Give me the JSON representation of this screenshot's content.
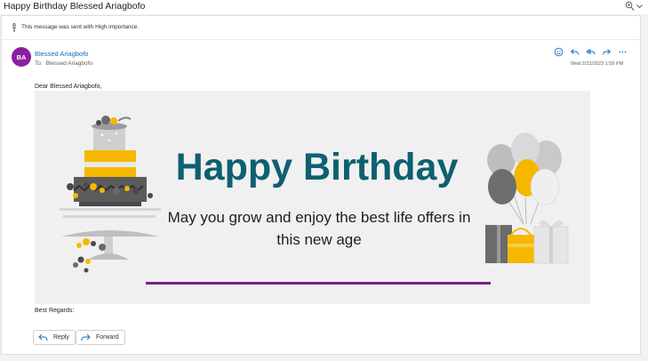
{
  "email": {
    "subject": "Happy Birthday Blessed Ariagbofo",
    "importance_notice": "This message was sent with High importance.",
    "sender": {
      "initials": "BA",
      "name": "Blessed Ariagbofo"
    },
    "to": {
      "label": "To:",
      "name": "Blessed Ariagbofo"
    },
    "date": "Wed 2/22/2023 1:59 PM",
    "greeting": "Dear Blessed Ariagbofo,",
    "signoff": "Best Regards:"
  },
  "banner": {
    "title": "Happy Birthday",
    "message": "May you grow and enjoy the best life offers in this new age"
  },
  "actions": {
    "icons": [
      "emoji-icon",
      "reply-icon",
      "reply-all-icon",
      "forward-icon",
      "more-icon"
    ],
    "reply_label": "Reply",
    "forward_label": "Forward"
  },
  "colors": {
    "avatar": "#8a1fa0",
    "link": "#0f6cbd",
    "banner_title": "#0e6070",
    "banner_rule": "#7a1f8a",
    "accent_yellow": "#f5b800",
    "gray_dark": "#5a5a5a"
  }
}
